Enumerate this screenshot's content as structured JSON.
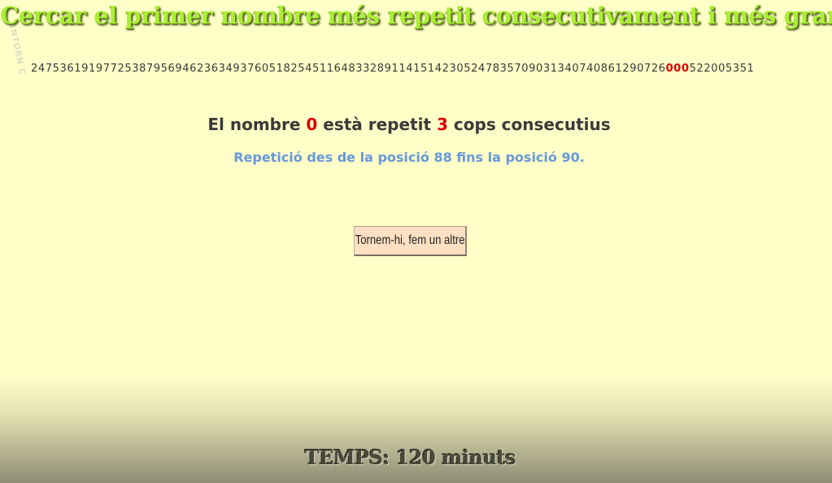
{
  "title": "Cercar el primer nombre més repetit consecutivament i més gran",
  "watermark": "ENTORN C",
  "sequence": {
    "before": "2475361919772538795694623634937605182545116483328911415142305247835709031340740861290726",
    "highlight": "000",
    "after": "522005351"
  },
  "result": {
    "prefix": "El nombre",
    "number": "0",
    "middle": "està repetit",
    "count": "3",
    "suffix": "cops consecutius"
  },
  "position_text": "Repetició des de la posició 88 fins la posició 90.",
  "retry_button_label": "Tornem-hi, fem un altre",
  "timer_text": "TEMPS: 120 minuts",
  "colors": {
    "background": "#ffffc8",
    "title": "#aaee33",
    "highlight": "#dd0000",
    "position_text": "#6699dd",
    "button_bg": "#ffe0c2"
  }
}
